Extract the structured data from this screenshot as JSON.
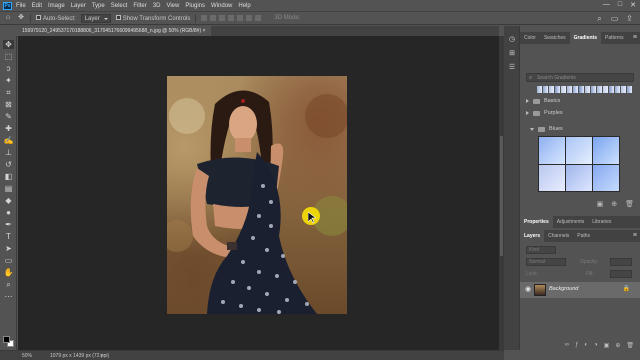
{
  "menubar": {
    "logo": "Ps",
    "items": [
      "File",
      "Edit",
      "Image",
      "Layer",
      "Type",
      "Select",
      "Filter",
      "3D",
      "View",
      "Plugins",
      "Window",
      "Help"
    ],
    "window_controls": [
      "—",
      "□",
      "✕"
    ]
  },
  "options": {
    "auto_select_label": "Auto-Select:",
    "auto_select_value": "Layer",
    "show_transform_label": "Show Transform Controls",
    "mode_label": "3D Mode:"
  },
  "document": {
    "tab_title": "159979120_249537170188806_3170451766099495688_n.jpg @ 50% (RGB/8#)"
  },
  "panels": {
    "top_tabs": [
      "Color",
      "Swatches",
      "Gradients",
      "Patterns"
    ],
    "top_active": "Gradients",
    "search_placeholder": "Search Gradients",
    "groups": [
      {
        "name": "Basics",
        "open": false
      },
      {
        "name": "Purples",
        "open": true
      }
    ],
    "subgroup": "Blues",
    "swatch_colors": [
      "#9fb3cf",
      "#8ea7c9",
      "#b6c3dc",
      "#7e98c4",
      "#c2cde0",
      "#a7b6d4",
      "#90a9d2",
      "#6f8cbc",
      "#b3c1dc",
      "#8aa3cc",
      "#a2b4d6",
      "#c6d1e4",
      "#7d95c2",
      "#97acd3",
      "#bac6df",
      "#8a9fc7"
    ],
    "blue_gradients": [
      [
        "#8fb0f0",
        "#d7e6ff"
      ],
      [
        "#a9c4f4",
        "#e5efff"
      ],
      [
        "#7aa4ee",
        "#cde0ff"
      ],
      [
        "#b9c8ee",
        "#e8ecff"
      ],
      [
        "#9fb6ea",
        "#dde6ff"
      ],
      [
        "#86a9f0",
        "#c6dafd"
      ]
    ],
    "mid_tabs": [
      "Properties",
      "Adjustments",
      "Libraries"
    ],
    "mid_active": "Properties",
    "layer_tabs": [
      "Layers",
      "Channels",
      "Paths"
    ],
    "layer_active": "Layers",
    "kind_label": "Kind",
    "blend_mode": "Normal",
    "opacity_label": "Opacity:",
    "lock_label": "Lock:",
    "fill_label": "Fill:",
    "layer_name": "Background"
  },
  "status": {
    "zoom": "50%",
    "dimensions": "1079 px x 1439 px (72 ppi)",
    "arrow": ">"
  }
}
